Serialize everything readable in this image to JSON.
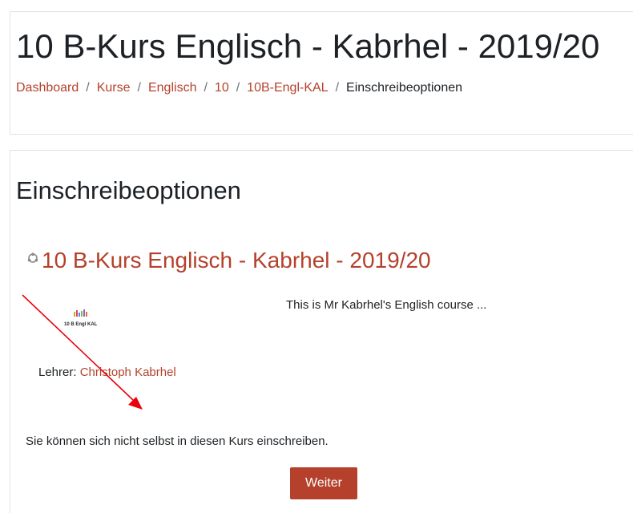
{
  "header": {
    "title": "10 B-Kurs Englisch - Kabrhel - 2019/20",
    "breadcrumb": [
      {
        "label": "Dashboard"
      },
      {
        "label": "Kurse"
      },
      {
        "label": "Englisch"
      },
      {
        "label": "10"
      },
      {
        "label": "10B-Engl-KAL"
      }
    ],
    "breadcrumb_separator": "/",
    "breadcrumb_current": "Einschreibeoptionen"
  },
  "main": {
    "section_title": "Einschreibeoptionen",
    "course": {
      "title": "10 B-Kurs Englisch - Kabrhel - 2019/20",
      "image_label": "10 B Engl KAL",
      "summary": "This is Mr Kabrhel's English course ...",
      "teacher_role": "Lehrer: ",
      "teacher_name": "Christoph Kabrhel"
    },
    "notice": "Sie können sich nicht selbst in diesen Kurs einschreiben.",
    "continue_label": "Weiter"
  },
  "colors": {
    "accent": "#b5412c",
    "annotation": "#e8000b",
    "text": "#1d2125",
    "border": "#dee2e6"
  }
}
